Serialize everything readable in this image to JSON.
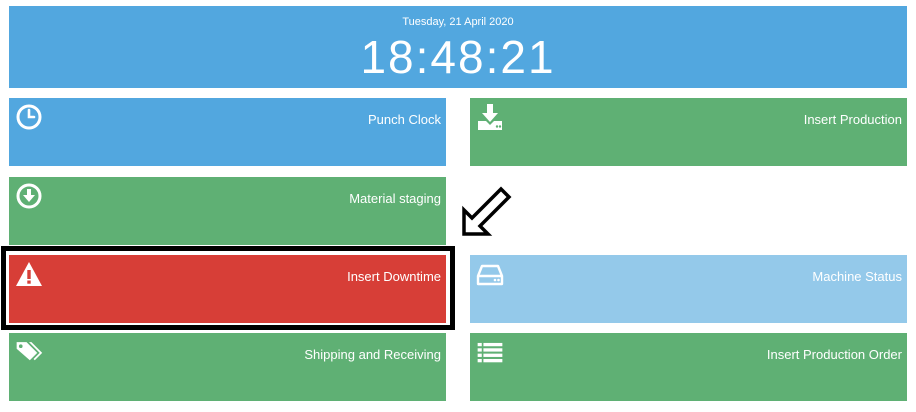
{
  "header": {
    "date": "Tuesday, 21 April 2020",
    "time": "18:48:21"
  },
  "tiles": [
    {
      "label": "Punch Clock",
      "icon": "clock-icon",
      "color": "#52a7df"
    },
    {
      "label": "Insert Production",
      "icon": "download-icon",
      "color": "#5fb074"
    },
    {
      "label": "Material staging",
      "icon": "arrow-down-circle-icon",
      "color": "#5fb074"
    },
    {
      "label": "Insert Downtime",
      "icon": "warning-icon",
      "color": "#d73e37"
    },
    {
      "label": "Machine Status",
      "icon": "hard-drive-icon",
      "color": "#94c9ea"
    },
    {
      "label": "Shipping and Receiving",
      "icon": "tags-icon",
      "color": "#5fb074"
    },
    {
      "label": "Insert Production Order",
      "icon": "list-icon",
      "color": "#5fb074"
    }
  ],
  "annotation": {
    "highlight_color": "#000000",
    "arrow_direction": "down-left"
  }
}
